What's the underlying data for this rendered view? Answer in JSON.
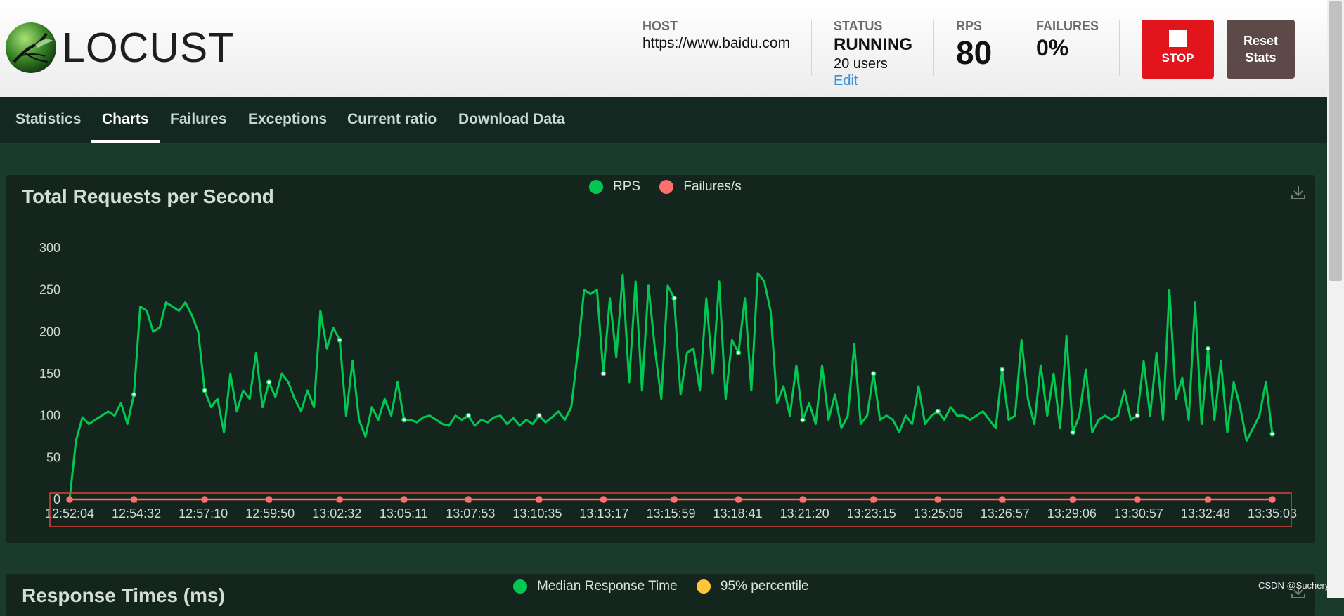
{
  "app": {
    "name": "LOCUST"
  },
  "header": {
    "host_label": "HOST",
    "host_value": "https://www.baidu.com",
    "status_label": "STATUS",
    "status_value": "RUNNING",
    "users_value": "20 users",
    "edit_label": "Edit",
    "rps_label": "RPS",
    "rps_value": "80",
    "failures_label": "FAILURES",
    "failures_value": "0%",
    "stop_label": "STOP",
    "reset_label": "Reset\nStats"
  },
  "tabs": [
    {
      "label": "Statistics",
      "active": false
    },
    {
      "label": "Charts",
      "active": true
    },
    {
      "label": "Failures",
      "active": false
    },
    {
      "label": "Exceptions",
      "active": false
    },
    {
      "label": "Current ratio",
      "active": false
    },
    {
      "label": "Download Data",
      "active": false
    }
  ],
  "icons": {
    "logo": "locust-logo-icon",
    "download": "download-icon",
    "stop": "stop-square-icon"
  },
  "colors": {
    "rps": "#00c853",
    "failures": "#ff6d6d",
    "median": "#00c853",
    "p95": "#ffc53d",
    "stop_button": "#e2141c",
    "reset_button": "#5d4a48"
  },
  "chart_data": {
    "type": "line",
    "title": "Total Requests per Second",
    "legend": [
      "RPS",
      "Failures/s"
    ],
    "legend_position": "top-center",
    "yticks": [
      "0",
      "50",
      "100",
      "150",
      "200",
      "250",
      "300"
    ],
    "ylim": [
      0,
      300
    ],
    "xticks": [
      "12:52:04",
      "12:54:32",
      "12:57:10",
      "12:59:50",
      "13:02:32",
      "13:05:11",
      "13:07:53",
      "13:10:35",
      "13:13:17",
      "13:15:59",
      "13:18:41",
      "13:21:20",
      "13:23:15",
      "13:25:06",
      "13:26:57",
      "13:29:06",
      "13:30:57",
      "13:32:48",
      "13:35:03"
    ],
    "series": [
      {
        "name": "RPS",
        "values": [
          0,
          70,
          98,
          90,
          95,
          100,
          105,
          100,
          115,
          90,
          125,
          230,
          225,
          200,
          205,
          235,
          230,
          225,
          235,
          220,
          200,
          130,
          110,
          120,
          80,
          150,
          105,
          130,
          120,
          175,
          110,
          140,
          122,
          150,
          140,
          120,
          105,
          130,
          110,
          225,
          180,
          205,
          190,
          100,
          165,
          95,
          75,
          110,
          95,
          120,
          100,
          140,
          95,
          95,
          92,
          98,
          100,
          95,
          90,
          88,
          100,
          95,
          100,
          88,
          95,
          92,
          98,
          100,
          90,
          97,
          88,
          95,
          90,
          100,
          92,
          98,
          105,
          95,
          110,
          175,
          250,
          245,
          250,
          150,
          240,
          170,
          268,
          140,
          260,
          130,
          255,
          180,
          120,
          255,
          240,
          125,
          175,
          180,
          130,
          240,
          150,
          260,
          120,
          190,
          175,
          240,
          130,
          270,
          260,
          225,
          115,
          135,
          100,
          160,
          95,
          115,
          90,
          160,
          95,
          125,
          85,
          100,
          185,
          90,
          100,
          150,
          95,
          100,
          95,
          80,
          100,
          90,
          135,
          90,
          100,
          105,
          95,
          110,
          100,
          100,
          95,
          100,
          105,
          95,
          85,
          155,
          95,
          100,
          190,
          120,
          90,
          160,
          100,
          150,
          85,
          195,
          80,
          100,
          155,
          80,
          95,
          100,
          95,
          100,
          130,
          95,
          100,
          165,
          100,
          175,
          95,
          250,
          120,
          145,
          95,
          235,
          90,
          180,
          95,
          165,
          80,
          140,
          110,
          70,
          85,
          100,
          140,
          78
        ]
      },
      {
        "name": "Failures/s",
        "values": [
          0,
          0,
          0,
          0,
          0,
          0,
          0,
          0,
          0,
          0,
          0,
          0,
          0,
          0,
          0,
          0,
          0,
          0,
          0,
          0,
          0,
          0,
          0,
          0,
          0,
          0,
          0,
          0,
          0,
          0,
          0,
          0,
          0,
          0,
          0,
          0,
          0,
          0,
          0,
          0,
          0,
          0,
          0,
          0,
          0,
          0,
          0,
          0,
          0,
          0,
          0,
          0,
          0,
          0,
          0,
          0,
          0,
          0,
          0,
          0,
          0,
          0,
          0,
          0,
          0,
          0,
          0,
          0,
          0,
          0,
          0,
          0,
          0,
          0,
          0,
          0,
          0,
          0,
          0,
          0,
          0,
          0,
          0,
          0,
          0,
          0,
          0,
          0,
          0,
          0,
          0,
          0,
          0,
          0,
          0,
          0,
          0,
          0,
          0,
          0,
          0,
          0,
          0,
          0,
          0,
          0,
          0,
          0,
          0,
          0,
          0,
          0,
          0,
          0,
          0,
          0,
          0,
          0,
          0,
          0,
          0,
          0,
          0,
          0,
          0,
          0,
          0,
          0,
          0,
          0,
          0,
          0,
          0,
          0,
          0,
          0,
          0,
          0,
          0,
          0,
          0,
          0,
          0,
          0,
          0,
          0,
          0,
          0,
          0,
          0,
          0,
          0,
          0,
          0,
          0,
          0,
          0,
          0,
          0,
          0,
          0,
          0,
          0,
          0,
          0,
          0,
          0,
          0,
          0,
          0,
          0,
          0,
          0,
          0,
          0,
          0,
          0,
          0,
          0,
          0,
          0,
          0,
          0,
          0,
          0,
          0,
          0,
          0
        ]
      }
    ]
  },
  "chart2": {
    "title": "Response Times (ms)",
    "legend": [
      "Median Response Time",
      "95% percentile"
    ]
  },
  "watermark": "CSDN @Suchery"
}
